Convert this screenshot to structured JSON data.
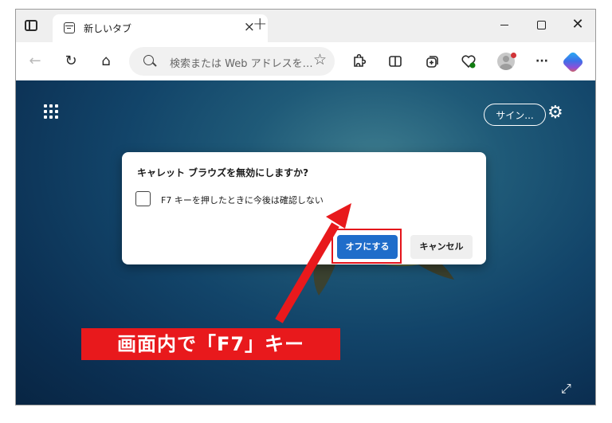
{
  "tab": {
    "title": "新しいタブ",
    "close_label": "×",
    "new_tab_label": "+"
  },
  "window": {
    "close_label": "✕"
  },
  "toolbar": {
    "back_icon": "←",
    "refresh_icon": "↻",
    "home_icon": "⌂",
    "address_placeholder": "検索または Web アドレスを…",
    "favorite_icon": "☆",
    "more_label": "···"
  },
  "page": {
    "sign_in_label": "サイン...",
    "settings_icon": "⚙",
    "expand_icon": "⤢"
  },
  "dialog": {
    "title": "キャレット ブラウズを無効にしますか?",
    "checkbox_label": "F7 キーを押したときに今後は確認しない",
    "confirm_label": "オフにする",
    "cancel_label": "キャンセル"
  },
  "annotation": {
    "callout_text": "画面内で「F7」キー"
  },
  "colors": {
    "accent": "#1f6dca",
    "annotation_red": "#e4141b"
  }
}
